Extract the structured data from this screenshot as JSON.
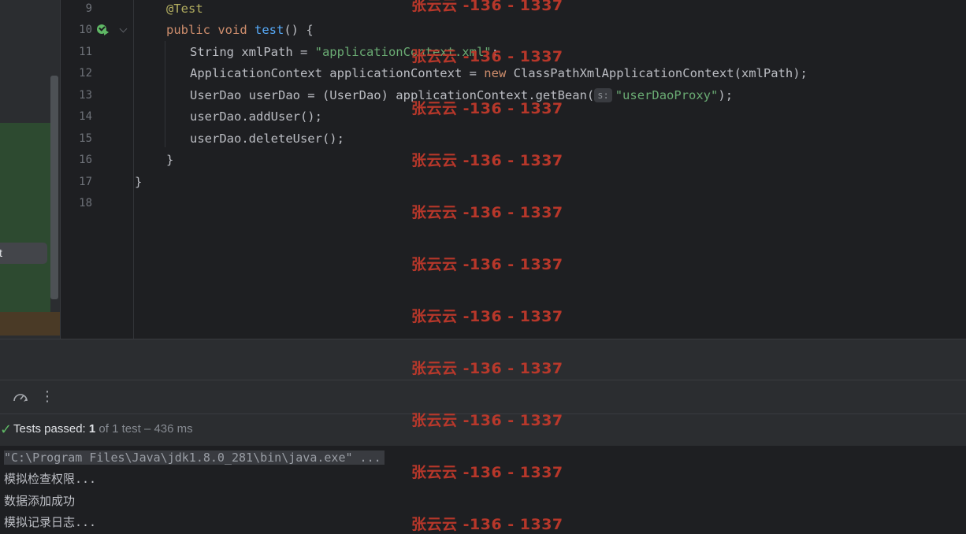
{
  "left_panel": {
    "selected_item_label": "st"
  },
  "editor": {
    "lines": [
      {
        "num": "9",
        "html_key": "l9"
      },
      {
        "num": "10",
        "html_key": "l10"
      },
      {
        "num": "11",
        "html_key": "l11"
      },
      {
        "num": "12",
        "html_key": "l12"
      },
      {
        "num": "13",
        "html_key": "l13"
      },
      {
        "num": "14",
        "html_key": "l14"
      },
      {
        "num": "15",
        "html_key": "l15"
      },
      {
        "num": "16",
        "html_key": "l16"
      },
      {
        "num": "17",
        "html_key": "l17"
      },
      {
        "num": "18",
        "html_key": "l18"
      }
    ],
    "code": {
      "l9_ann": "@Test",
      "l10_kw1": "public",
      "l10_kw2": "void",
      "l10_fn": "test",
      "l10_rest": "() {",
      "l11_pre": "String xmlPath = ",
      "l11_str": "\"applicationContext.xml\"",
      "l11_post": ";",
      "l12_pre": "ApplicationContext applicationContext = ",
      "l12_kw": "new",
      "l12_post": " ClassPathXmlApplicationContext(xmlPath);",
      "l13_pre": "UserDao userDao = (UserDao) applicationContext.getBean(",
      "l13_hint": "s:",
      "l13_str": "\"userDaoProxy\"",
      "l13_post": ");",
      "l14": "userDao.addUser();",
      "l15": "userDao.deleteUser();",
      "l16": "}",
      "l17": "}"
    },
    "icons": [
      "run-test-passed-icon",
      "fold-icon"
    ]
  },
  "run_toolbar": {
    "icons": [
      "toolbar-divider-icon",
      "speedometer-icon",
      "more-options-icon"
    ]
  },
  "tests_bar": {
    "check_icon": "check-icon",
    "label": "Tests passed:",
    "passed": "1",
    "of_total": "of 1 test",
    "duration": "– 436 ms"
  },
  "console": {
    "cmd": "\"C:\\Program Files\\Java\\jdk1.8.0_281\\bin\\java.exe\" ...",
    "out1": "模拟检查权限...",
    "out2": "数据添加成功",
    "out3": "模拟记录日志..."
  },
  "watermark": {
    "text": "张云云 -136 - 1337"
  },
  "colors": {
    "keyword": "#cf8e6d",
    "string": "#6aab73",
    "function": "#56a8f5",
    "annotation": "#b3ae60",
    "watermark": "#c0392b",
    "pass": "#5fb865"
  }
}
